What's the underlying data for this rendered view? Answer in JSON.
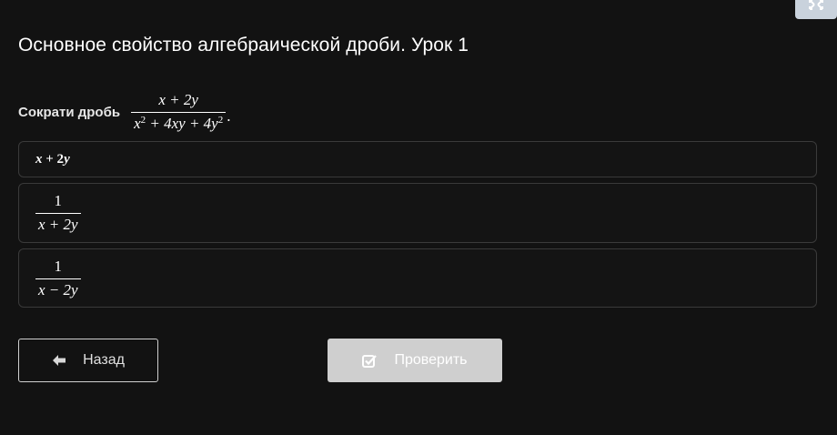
{
  "header": {
    "title": "Основное свойство алгебраической дроби. Урок 1",
    "expand_icon": "expand-icon"
  },
  "question": {
    "prompt": "Сократи дробь",
    "fraction": {
      "numerator": "x + 2y",
      "denominator_base": "x",
      "denominator_parts": [
        "x",
        "2",
        " + 4xy + 4",
        "y",
        "2"
      ]
    },
    "period": "."
  },
  "options": [
    {
      "type": "inline",
      "x": "x",
      "rest": " + 2",
      "y": "y"
    },
    {
      "type": "fraction",
      "numerator": "1",
      "denominator": "x + 2y"
    },
    {
      "type": "fraction",
      "numerator": "1",
      "denominator": "x − 2y"
    }
  ],
  "buttons": {
    "back_label": "Назад",
    "back_icon": "arrow-left-icon",
    "check_label": "Проверить",
    "check_icon": "checkbox-icon"
  },
  "colors": {
    "background": "#121212",
    "option_border": "#3a3a3a",
    "check_button_bg": "#cfcfcf",
    "expand_button_bg": "#c9d2dc"
  }
}
